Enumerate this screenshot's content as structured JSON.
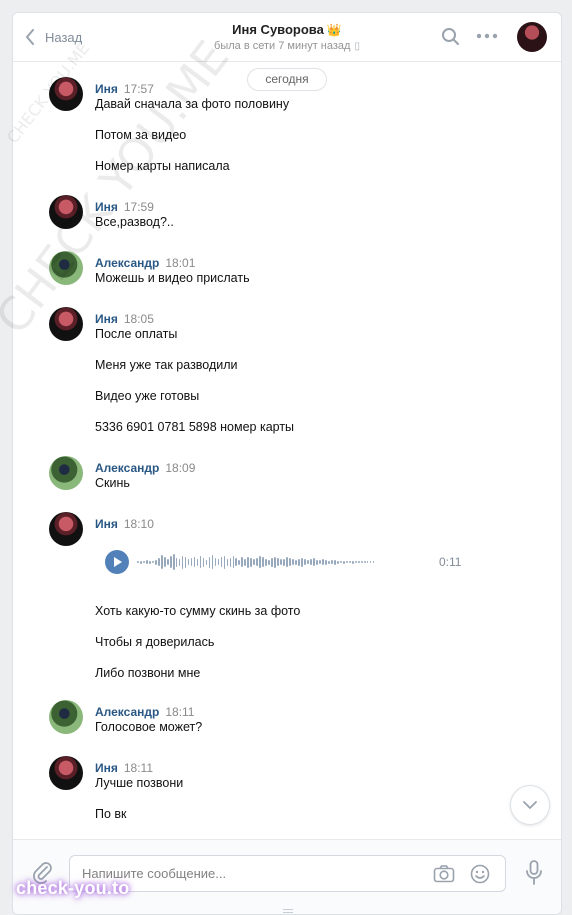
{
  "header": {
    "back_label": "Назад",
    "contact_name": "Иня Суворова",
    "crown": "👑",
    "status": "была в сети 7 минут назад"
  },
  "chat": {
    "date_label": "сегодня",
    "messages": [
      {
        "author": "Иня",
        "time": "17:57",
        "lines": [
          "Давай сначала за фото половину",
          "Потом за видео",
          "Номер карты написала"
        ]
      },
      {
        "author": "Иня",
        "time": "17:59",
        "lines": [
          "Все,развод?.."
        ]
      },
      {
        "author": "Александр",
        "time": "18:01",
        "lines": [
          "Можешь и видео прислать"
        ]
      },
      {
        "author": "Иня",
        "time": "18:05",
        "lines": [
          "После оплаты",
          "Меня уже так разводили",
          "Видео уже готовы",
          "5336 6901 0781 5898 номер карты"
        ]
      },
      {
        "author": "Александр",
        "time": "18:09",
        "lines": [
          "Скинь"
        ]
      },
      {
        "author": "Иня",
        "time": "18:10",
        "voice_duration": "0:11",
        "lines": [
          "Хоть какую-то сумму скинь за фото",
          "Чтобы я доверилась",
          "Либо позвони мне"
        ]
      },
      {
        "author": "Александр",
        "time": "18:11",
        "lines": [
          "Голосовое может?"
        ]
      },
      {
        "author": "Иня",
        "time": "18:11",
        "lines": [
          "Лучше позвони",
          "По вк"
        ]
      }
    ]
  },
  "composer": {
    "placeholder": "Напишите сообщение..."
  },
  "watermarks": {
    "diagonal_big": "CHECK YOU.ME",
    "diagonal_small": "CHECK YOU.ME",
    "logo": "check-you.to"
  },
  "icons": [
    "chevron-left-icon",
    "search-icon",
    "more-icon",
    "phone-icon",
    "play-icon",
    "chevron-down-icon",
    "paperclip-icon",
    "camera-icon",
    "smile-icon",
    "microphone-icon"
  ]
}
